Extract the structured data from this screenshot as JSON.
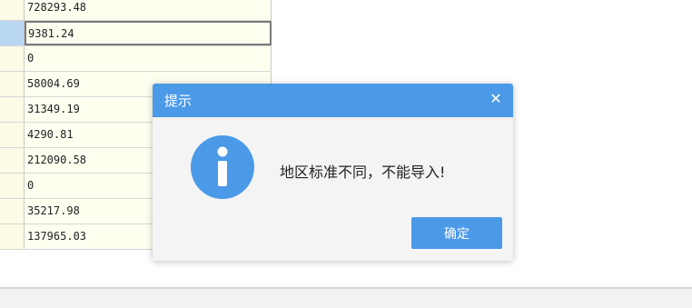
{
  "grid": {
    "rows": [
      {
        "value": "728293.48",
        "selected": false
      },
      {
        "value": "9381.24",
        "selected": true
      },
      {
        "value": "0",
        "selected": false
      },
      {
        "value": "58004.69",
        "selected": false
      },
      {
        "value": "31349.19",
        "selected": false
      },
      {
        "value": "4290.81",
        "selected": false
      },
      {
        "value": "212090.58",
        "selected": false
      },
      {
        "value": "0",
        "selected": false
      },
      {
        "value": "35217.98",
        "selected": false
      },
      {
        "value": "137965.03",
        "selected": false
      }
    ]
  },
  "dialog": {
    "title": "提示",
    "close_symbol": "✕",
    "message": "地区标准不同，不能导入!",
    "ok_label": "确定",
    "icon": "info-icon",
    "colors": {
      "header": "#4b9ae8",
      "icon": "#4b9ae8",
      "button": "#4b9ae8"
    }
  }
}
